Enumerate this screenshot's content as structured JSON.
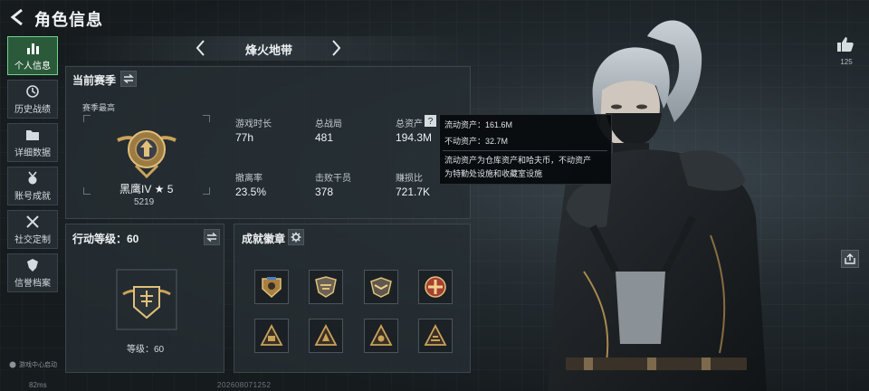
{
  "header": {
    "title": "角色信息"
  },
  "sidebar": {
    "items": [
      {
        "label": "个人信息",
        "icon": "bar-chart-icon",
        "active": true
      },
      {
        "label": "历史战绩",
        "icon": "clock-icon"
      },
      {
        "label": "详细数据",
        "icon": "folder-icon"
      },
      {
        "label": "账号成就",
        "icon": "medal-icon"
      },
      {
        "label": "社交定制",
        "icon": "tools-icon"
      },
      {
        "label": "信誉档案",
        "icon": "shield-icon"
      }
    ],
    "footer_text": "游戏中心启动",
    "ping": "82ms"
  },
  "mode": {
    "title": "烽火地带"
  },
  "season": {
    "title": "当前赛季",
    "best_label": "赛季最高",
    "rank_name": "黑鹰IV ★ 5",
    "rank_score": "5219",
    "stats": [
      {
        "label": "游戏时长",
        "value": "77h"
      },
      {
        "label": "总战局",
        "value": "481"
      },
      {
        "label": "总资产",
        "value": "194.3M"
      },
      {
        "label": "撤离率",
        "value": "23.5%"
      },
      {
        "label": "击败干员",
        "value": "378"
      },
      {
        "label": "赚损比",
        "value": "721.7K"
      }
    ]
  },
  "tooltip": {
    "liquid": "流动资产：161.6M",
    "fixed": "不动资产：32.7M",
    "desc_line1": "流动资产为仓库资产和哈夫币，不动资产",
    "desc_line2": "为特勤处设施和收藏室设施"
  },
  "action_level": {
    "title": "行动等级：60",
    "level_text": "等级：60"
  },
  "badges": {
    "title": "成就徽章"
  },
  "social": {
    "like_count": "125"
  },
  "footer": {
    "uid": "202608071252"
  },
  "colors": {
    "accent_green": "#6fd18f",
    "panel_bg": "#262e33",
    "gold": "#c9a35a"
  }
}
